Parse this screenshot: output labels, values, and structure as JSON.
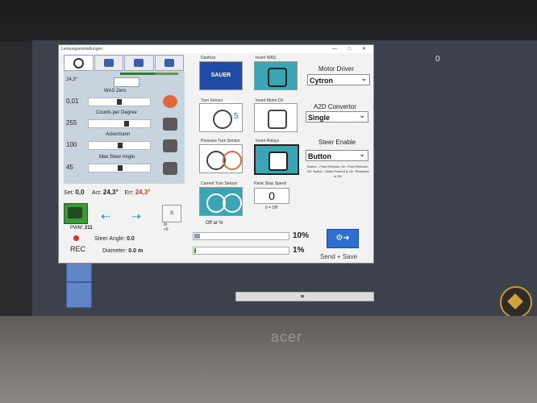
{
  "window": {
    "title": "Lenkungseinstellungen",
    "buttons": [
      "—",
      "□",
      "✕"
    ]
  },
  "left_panel": {
    "angle_top": "24,3°",
    "was_zero": {
      "label": "WAS Zero",
      "value": "0,01"
    },
    "counts": {
      "label": "Counts per Degree",
      "value": "255"
    },
    "ackermann": {
      "label": "Ackermann",
      "value": "100"
    },
    "max_steer": {
      "label": "Max Steer Angle",
      "value": "45"
    },
    "set_label": "Set:",
    "set_value": "0,0",
    "act_label": "Act:",
    "act_value": "24,3°",
    "err_label": "Err:",
    "err_value": "24,3°",
    "pwm_label": "PWM:",
    "pwm_value": "211",
    "zero_btn": "0",
    "zero_sub": "0r +5",
    "steer_angle_label": "Steer Angle:",
    "steer_angle_value": "0.0",
    "diameter_label": "Diameter:",
    "diameter_value": "0.0 m",
    "rec_label": "REC"
  },
  "cards": {
    "danfoss": {
      "label": "Danfoss",
      "logo": "SAUER DANFOSS"
    },
    "invert_was": {
      "label": "Invert WAS"
    },
    "turn_sensor": {
      "label": "Turn Sensor",
      "digit": "5"
    },
    "invert_motor": {
      "label": "Invert Motor Dir"
    },
    "pressure": {
      "label": "Pressure Turn Sensor"
    },
    "invert_relays": {
      "label": "Invert Relays"
    },
    "current": {
      "label": "Current Turn Sensor"
    },
    "panic": {
      "label": "Panic Stop Speed",
      "value": "0",
      "sub": "0 = Off"
    }
  },
  "right": {
    "motor_driver_label": "Motor Driver",
    "motor_driver_value": "Cytron",
    "a2d_label": "A2D Convertor",
    "a2d_value": "Single",
    "steer_enable_label": "Steer Enable",
    "steer_enable_value": "Button",
    "note": "Button - Push Release, On. Push Release, Off. Switch - While Pushed is On. Released is Off."
  },
  "bottom": {
    "off_at_label": "Off at %",
    "pct1": "10%",
    "pct1_fill": 0.06,
    "pct2": "1%",
    "pct2_fill": 0.01,
    "send_save": "Send + Save"
  },
  "screen": {
    "corner_num": "0"
  }
}
